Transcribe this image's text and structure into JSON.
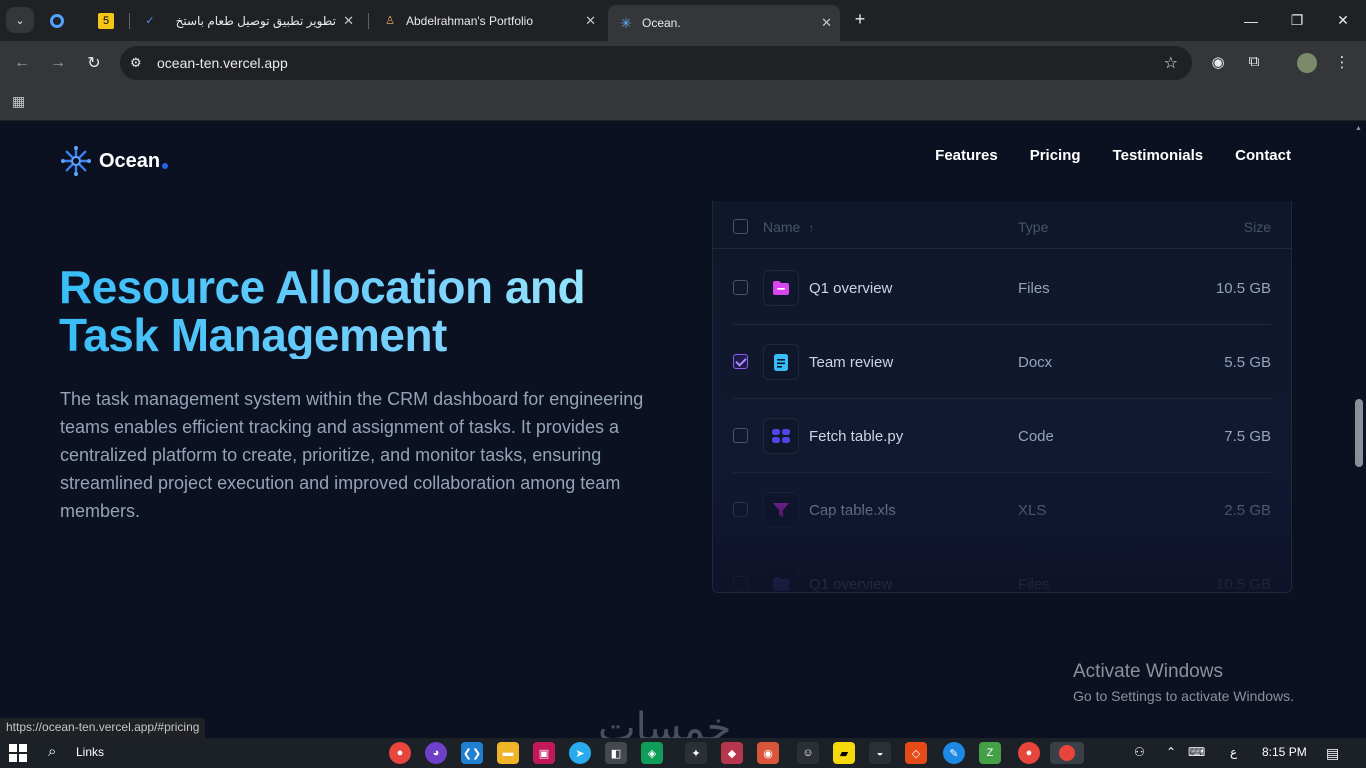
{
  "browser": {
    "tabs": [
      {
        "title": "",
        "favicon": "5"
      },
      {
        "title": "تطوير تطبيق توصيل طعام باستخ",
        "favicon": "check-logo"
      },
      {
        "title": "Abdelrahman's Portfolio",
        "favicon": "portfolio"
      },
      {
        "title": "Ocean.",
        "favicon": "ocean"
      }
    ],
    "url": "ocean-ten.vercel.app",
    "status_url": "https://ocean-ten.vercel.app/#pricing"
  },
  "site": {
    "logo_text": "Ocean",
    "nav": [
      "Features",
      "Pricing",
      "Testimonials",
      "Contact"
    ],
    "hero": {
      "title_line1": "Resource Allocation and",
      "title_line2": "Task Management",
      "description": "The task management system within the CRM dashboard for engineering teams enables efficient tracking and assignment of tasks. It provides a centralized platform to create, prioritize, and monitor tasks, ensuring streamlined project execution and improved collaboration among team members."
    },
    "table": {
      "headers": {
        "name": "Name",
        "sort_arrow": "↑",
        "type": "Type",
        "size": "Size"
      },
      "rows": [
        {
          "name": "Q1 overview",
          "type": "Files",
          "size": "10.5 GB",
          "checked": false,
          "icon": "folder-icon",
          "color": "#d946ef"
        },
        {
          "name": "Team review",
          "type": "Docx",
          "size": "5.5 GB",
          "checked": true,
          "icon": "document-icon",
          "color": "#38bdf8"
        },
        {
          "name": "Fetch table.py",
          "type": "Code",
          "size": "7.5 GB",
          "checked": false,
          "icon": "code-icon",
          "color": "#4f46e5"
        },
        {
          "name": "Cap table.xls",
          "type": "XLS",
          "size": "2.5 GB",
          "checked": false,
          "icon": "funnel-icon",
          "color": "#c026d3"
        },
        {
          "name": "Q1 overview",
          "type": "Files",
          "size": "10.5 GB",
          "checked": false,
          "icon": "folder-icon",
          "color": "#6366f1"
        }
      ]
    }
  },
  "overlay": {
    "activate_title": "Activate Windows",
    "activate_sub": "Go to Settings to activate Windows.",
    "watermark": "خمسات"
  },
  "taskbar": {
    "links_label": "Links",
    "lang": "ع",
    "time": "8:15 PM"
  }
}
